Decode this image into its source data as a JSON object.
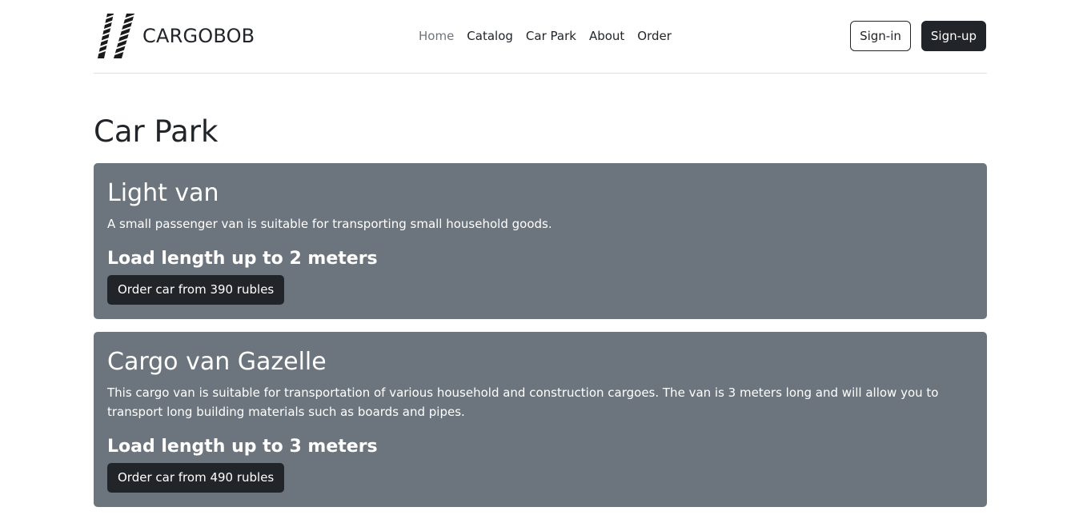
{
  "brand": {
    "name": "CARGOBOB",
    "logo_icon": "tire-tracks-icon"
  },
  "nav": {
    "items": [
      {
        "label": "Home",
        "active": true
      },
      {
        "label": "Catalog",
        "active": false
      },
      {
        "label": "Car Park",
        "active": false
      },
      {
        "label": "About",
        "active": false
      },
      {
        "label": "Order",
        "active": false
      }
    ]
  },
  "auth": {
    "signin_label": "Sign-in",
    "signup_label": "Sign-up"
  },
  "page": {
    "title": "Car Park"
  },
  "cars": [
    {
      "title": "Light van",
      "description": "A small passenger van is suitable for transporting small household goods.",
      "load": "Load length up to 2 meters",
      "order_label": "Order car from 390 rubles"
    },
    {
      "title": "Cargo van Gazelle",
      "description": "This cargo van is suitable for transportation of various household and construction cargoes. The van is 3 meters long and will allow you to transport long building materials such as boards and pipes.",
      "load": "Load length up to 3 meters",
      "order_label": "Order car from 490 rubles"
    }
  ],
  "colors": {
    "card_bg": "#6c757d",
    "dark": "#212529",
    "muted": "#6c757d",
    "border": "#dee2e6"
  }
}
